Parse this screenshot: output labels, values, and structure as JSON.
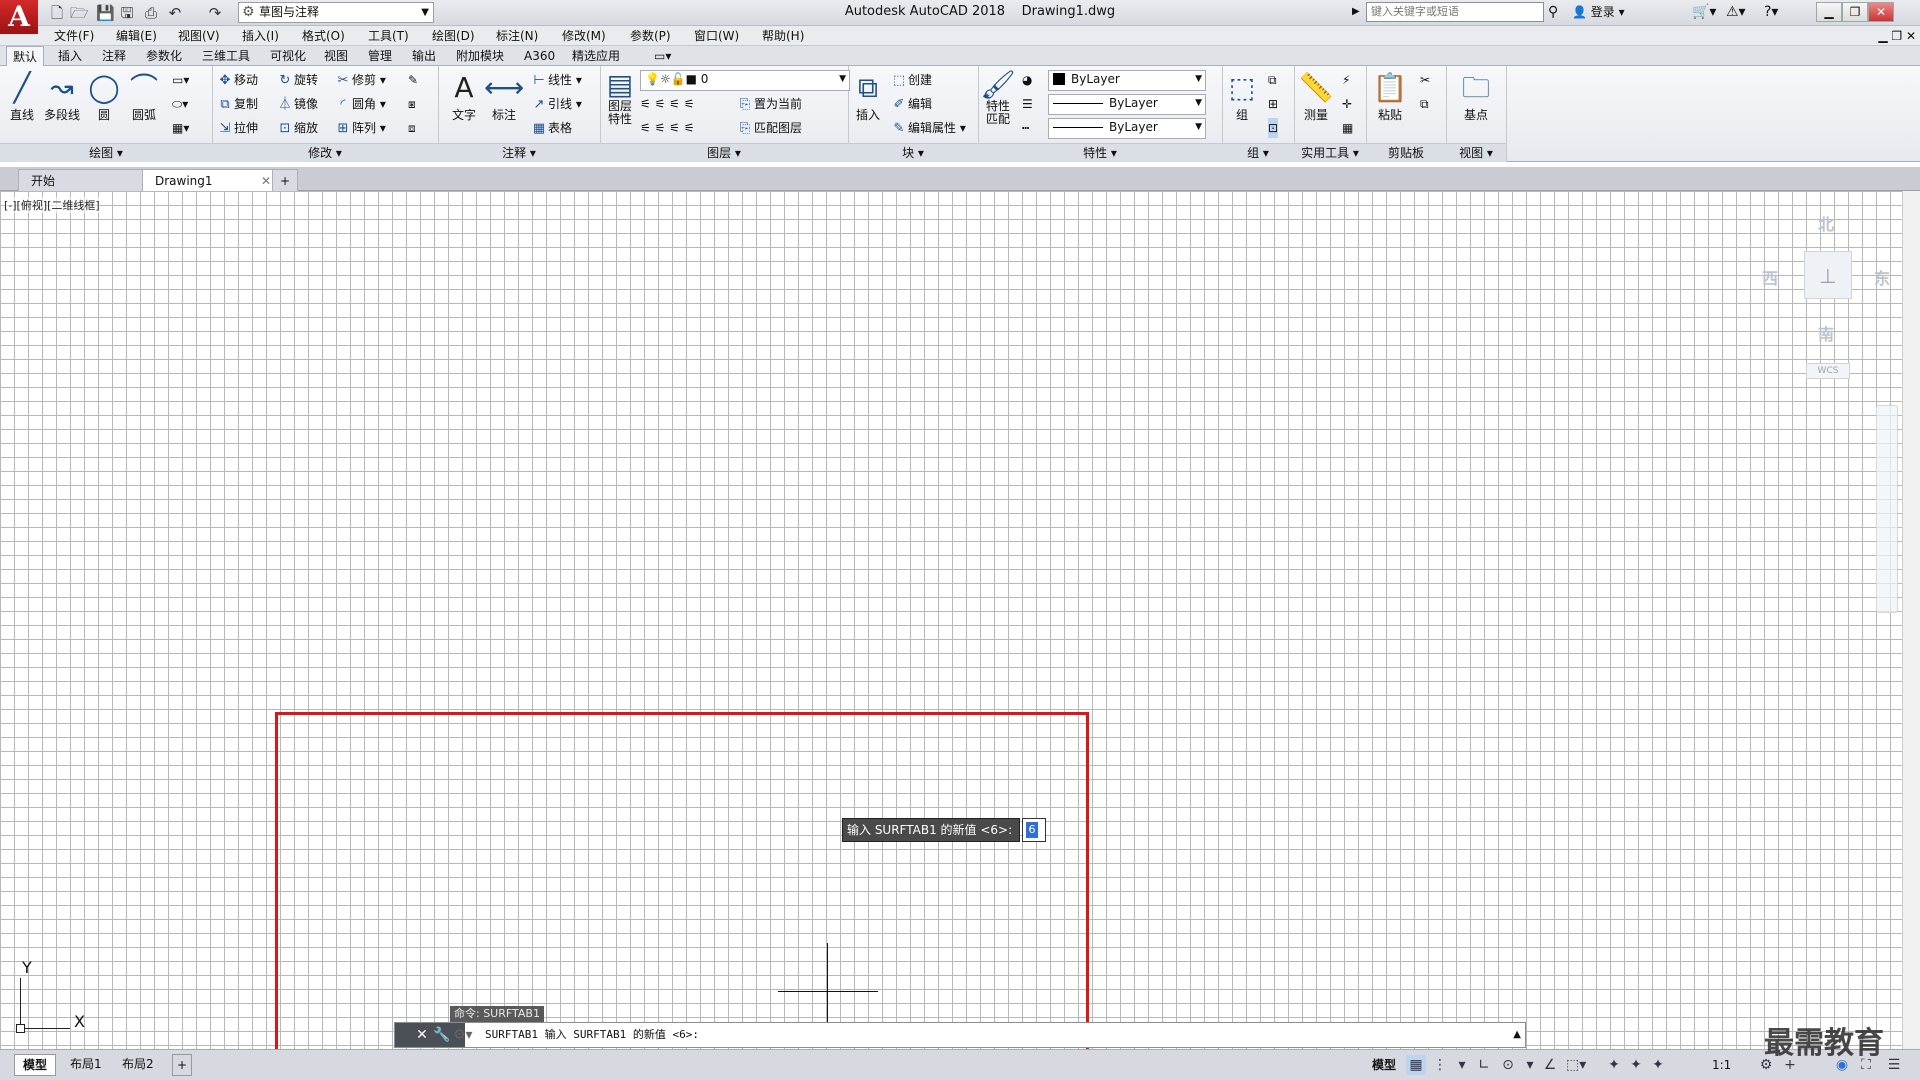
{
  "app": {
    "logo": "A",
    "title": "Autodesk AutoCAD 2018    Drawing1.dwg",
    "workspace": "草图与注释",
    "search_placeholder": "键入关键字或短语",
    "login": "登录"
  },
  "menu": [
    "文件(F)",
    "编辑(E)",
    "视图(V)",
    "插入(I)",
    "格式(O)",
    "工具(T)",
    "绘图(D)",
    "标注(N)",
    "修改(M)",
    "参数(P)",
    "窗口(W)",
    "帮助(H)"
  ],
  "ribbon_tabs": [
    "默认",
    "插入",
    "注释",
    "参数化",
    "三维工具",
    "可视化",
    "视图",
    "管理",
    "输出",
    "附加模块",
    "A360",
    "精选应用"
  ],
  "panels": {
    "draw": {
      "title": "绘图 ▾",
      "line": "直线",
      "polyline": "多段线",
      "circle": "圆",
      "arc": "圆弧"
    },
    "modify": {
      "title": "修改 ▾",
      "move": "移动",
      "rotate": "旋转",
      "trim": "修剪",
      "copy": "复制",
      "mirror": "镜像",
      "fillet": "圆角",
      "stretch": "拉伸",
      "scale": "缩放",
      "array": "阵列"
    },
    "annotation": {
      "title": "注释 ▾",
      "text": "文字",
      "dimension": "标注",
      "linear": "线性",
      "leader": "引线",
      "table": "表格"
    },
    "layers": {
      "title": "图层 ▾",
      "properties": "图层\n特性",
      "layer_value": "0",
      "make_current": "置为当前",
      "match_layer": "匹配图层"
    },
    "block": {
      "title": "块 ▾",
      "insert": "插入",
      "create": "创建",
      "edit": "编辑",
      "edit_attr": "编辑属性"
    },
    "properties": {
      "title": "特性 ▾",
      "match": "特性\n匹配",
      "color": "ByLayer",
      "linetype": "ByLayer",
      "lineweight": "ByLayer"
    },
    "groups": {
      "title": "组 ▾",
      "group": "组"
    },
    "utilities": {
      "title": "实用工具 ▾",
      "measure": "测量"
    },
    "clipboard": {
      "title": "剪贴板",
      "paste": "粘贴"
    },
    "view": {
      "title": "视图 ▾",
      "base": "基点"
    }
  },
  "doc_tabs": [
    "开始",
    "Drawing1"
  ],
  "viewport_label": "[-][俯视][二维线框]",
  "viewcube": {
    "north": "北",
    "south": "南",
    "east": "东",
    "west": "西",
    "wcs": "WCS"
  },
  "ucs": {
    "x": "X",
    "y": "Y"
  },
  "dynamic_input": {
    "prompt": "输入 SURFTAB1 的新值 <6>:",
    "value": "6"
  },
  "command": {
    "history": "命令: SURFTAB1",
    "current": "SURFTAB1 输入 SURFTAB1 的新值 <6>:"
  },
  "layout_tabs": [
    "模型",
    "布局1",
    "布局2"
  ],
  "status": {
    "model": "模型",
    "scale": "1:1"
  },
  "watermark": "最需教育",
  "colors": {
    "accent": "#e01515",
    "logo": "#c21e1e"
  }
}
